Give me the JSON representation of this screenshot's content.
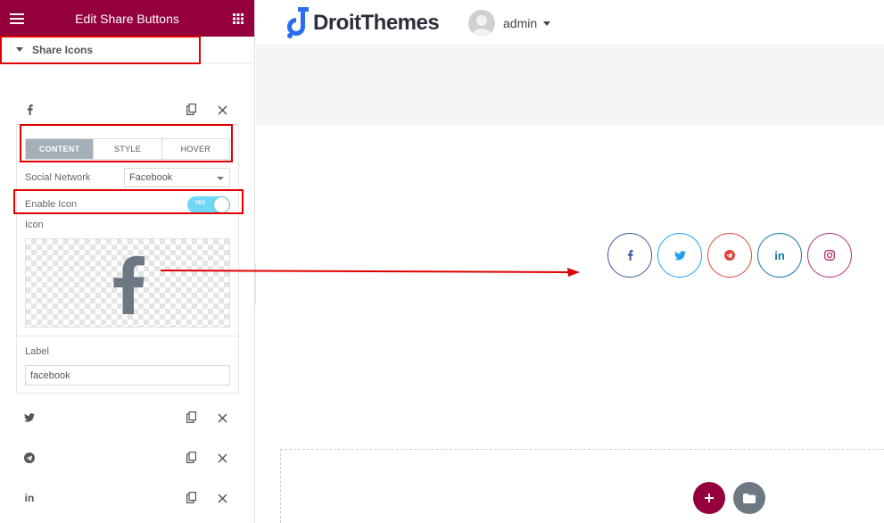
{
  "panel": {
    "title": "Edit Share Buttons",
    "section_title": "Share Icons",
    "items": [
      {
        "network": "facebook",
        "glyph": "f"
      },
      {
        "network": "twitter",
        "glyph": "twitter"
      },
      {
        "network": "telegram",
        "glyph": "telegram"
      },
      {
        "network": "linkedin",
        "glyph": "in"
      }
    ],
    "tabs": [
      "CONTENT",
      "STYLE",
      "HOVER"
    ],
    "active_tab": "CONTENT",
    "social_network_label": "Social Network",
    "social_network_value": "Facebook",
    "enable_icon_label": "Enable Icon",
    "enable_icon_toggle": "YES",
    "icon_label": "Icon",
    "icon_preview": "facebook-f-icon",
    "label_label": "Label",
    "label_value": "facebook"
  },
  "site": {
    "brand": "DroitThemes",
    "user_name": "admin"
  },
  "share_buttons": [
    {
      "network": "facebook",
      "color": "#3b5998",
      "glyph": "f"
    },
    {
      "network": "twitter",
      "color": "#1da1f2",
      "glyph": "tw"
    },
    {
      "network": "telegram",
      "color": "#e0453a",
      "glyph": "tg"
    },
    {
      "network": "linkedin",
      "color": "#0e76a8",
      "glyph": "in"
    },
    {
      "network": "instagram",
      "color": "#b5336a",
      "glyph": "ig"
    }
  ],
  "colors": {
    "panel_header": "#93003c",
    "highlight": "#e00000",
    "add_button": "#93003c",
    "folder_button": "#6d7882"
  }
}
